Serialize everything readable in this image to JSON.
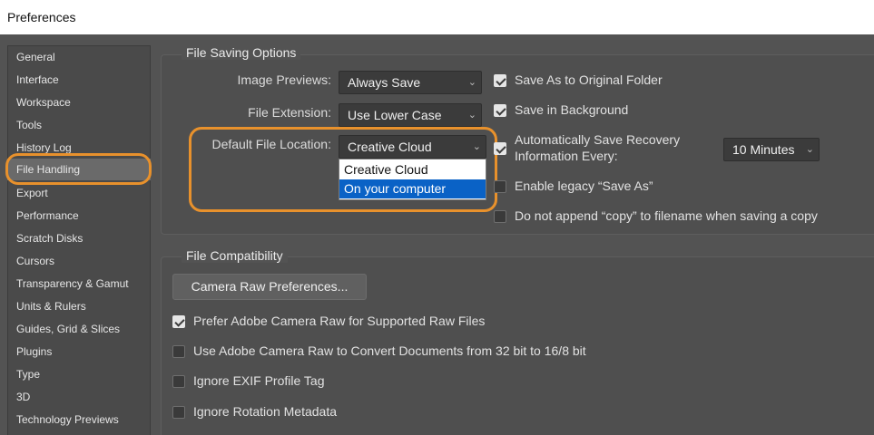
{
  "window": {
    "title": "Preferences"
  },
  "sidebar": {
    "items": [
      "General",
      "Interface",
      "Workspace",
      "Tools",
      "History Log",
      "File Handling",
      "Export",
      "Performance",
      "Scratch Disks",
      "Cursors",
      "Transparency & Gamut",
      "Units & Rulers",
      "Guides, Grid & Slices",
      "Plugins",
      "Type",
      "3D",
      "Technology Previews"
    ],
    "selected": "File Handling"
  },
  "file_saving": {
    "title": "File Saving Options",
    "image_previews": {
      "label": "Image Previews:",
      "value": "Always Save"
    },
    "file_extension": {
      "label": "File Extension:",
      "value": "Use Lower Case"
    },
    "default_location": {
      "label": "Default File Location:",
      "value": "Creative Cloud",
      "options": [
        "Creative Cloud",
        "On your computer"
      ],
      "highlighted_option": "On your computer"
    },
    "save_original_folder": {
      "label": "Save As to Original Folder",
      "checked": true
    },
    "save_background": {
      "label": "Save in Background",
      "checked": true
    },
    "auto_recovery": {
      "label_line1": "Automatically Save Recovery",
      "label_line2": "Information Every:",
      "checked": true,
      "interval": "10 Minutes"
    },
    "legacy_save_as": {
      "label": "Enable legacy “Save As”",
      "checked": false
    },
    "no_copy_append": {
      "label": "Do not append “copy” to filename when saving a copy",
      "checked": false
    }
  },
  "file_compat": {
    "title": "File Compatibility",
    "camera_raw_button": "Camera Raw Preferences...",
    "options": [
      {
        "label": "Prefer Adobe Camera Raw for Supported Raw Files",
        "checked": true
      },
      {
        "label": "Use Adobe Camera Raw to Convert Documents from 32 bit to 16/8 bit",
        "checked": false
      },
      {
        "label": "Ignore EXIF Profile Tag",
        "checked": false
      },
      {
        "label": "Ignore Rotation Metadata",
        "checked": false
      }
    ]
  },
  "colors": {
    "highlight": "#e8912c",
    "selection": "#0a62c6"
  }
}
